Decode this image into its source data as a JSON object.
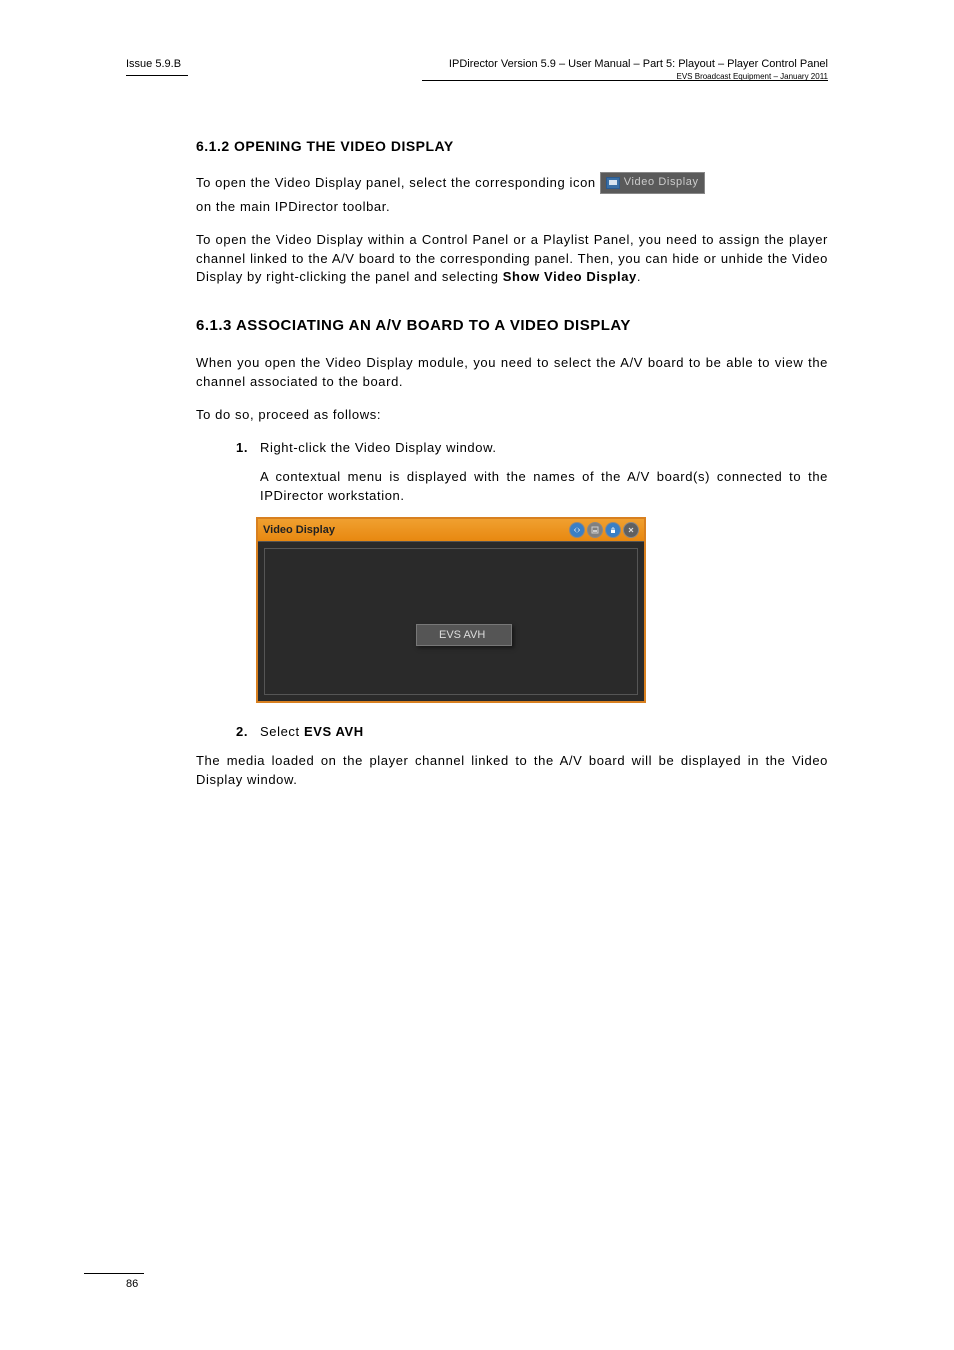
{
  "header": {
    "issue": "Issue 5.9.B",
    "product_line": "IPDirector Version 5.9 – User Manual – Part 5: Playout – Player Control Panel",
    "company_line": "EVS Broadcast Equipment – January 2011"
  },
  "section1": {
    "heading": "6.1.2 OPENING THE VIDEO DISPLAY",
    "para1_pre": "To open the Video Display panel, select the corresponding icon",
    "para1_post": "on the main IPDirector toolbar.",
    "icon_label": "Video Display",
    "para2": "To open the Video Display within a Control Panel or a Playlist Panel, you need to assign the player channel linked to the A/V board to the corresponding panel. Then, you can hide or unhide the Video Display by right-clicking the panel and selecting",
    "para2_cmd": "Show Video Display",
    "para2_end": "."
  },
  "section2": {
    "heading": "6.1.3 ASSOCIATING AN A/V BOARD TO A VIDEO DISPLAY",
    "para1": "When you open the Video Display module, you need to select the A/V board to be able to view the channel associated to the board.",
    "para2": "To do so, proceed as follows:",
    "step1_num": "1.",
    "step1_text": "Right-click the Video Display window.",
    "step1b": "A contextual menu is displayed with the names of the A/V board(s) connected to the IPDirector workstation.",
    "screenshot": {
      "title": "Video Display",
      "menu_item": "EVS AVH"
    },
    "step2_num": "2.",
    "step2_pre": "Select",
    "step2_bold": "EVS AVH",
    "para_last": "The media loaded on the player channel linked to the A/V board will be displayed in the Video Display window."
  },
  "footer": {
    "page": "86"
  }
}
